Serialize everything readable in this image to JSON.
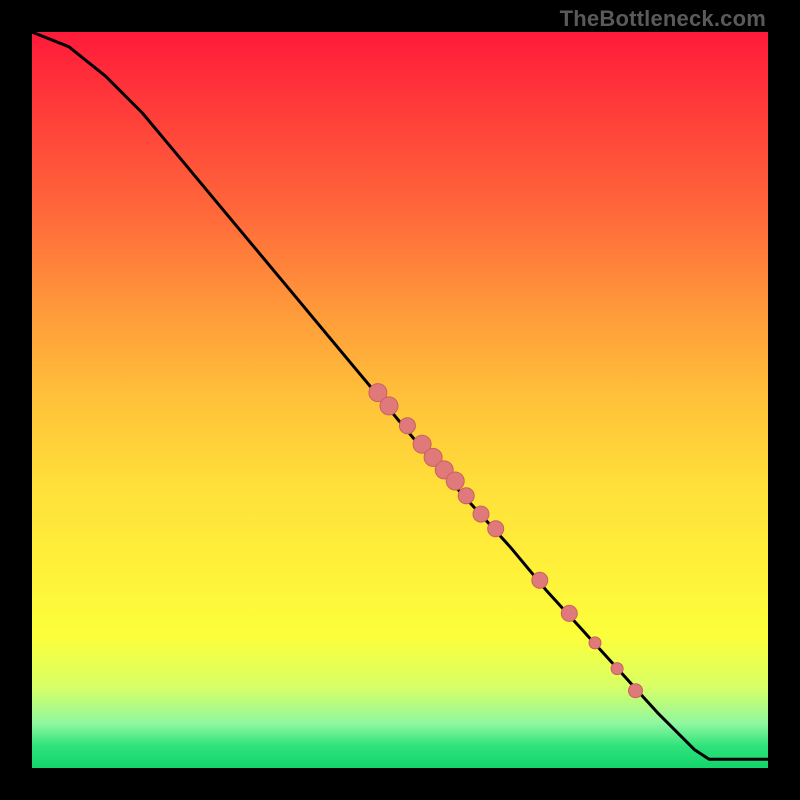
{
  "attribution": "TheBottleneck.com",
  "colors": {
    "curve": "#000000",
    "point_fill": "#e07a7a",
    "point_stroke": "#c96060"
  },
  "chart_data": {
    "type": "line",
    "title": "",
    "xlabel": "",
    "ylabel": "",
    "xlim": [
      0,
      100
    ],
    "ylim": [
      0,
      100
    ],
    "curve": [
      {
        "x": 0,
        "y": 100
      },
      {
        "x": 5,
        "y": 98
      },
      {
        "x": 10,
        "y": 94
      },
      {
        "x": 15,
        "y": 89
      },
      {
        "x": 20,
        "y": 83
      },
      {
        "x": 25,
        "y": 77
      },
      {
        "x": 30,
        "y": 71
      },
      {
        "x": 35,
        "y": 65
      },
      {
        "x": 40,
        "y": 59
      },
      {
        "x": 45,
        "y": 53
      },
      {
        "x": 50,
        "y": 47
      },
      {
        "x": 55,
        "y": 41
      },
      {
        "x": 60,
        "y": 35.5
      },
      {
        "x": 65,
        "y": 30
      },
      {
        "x": 70,
        "y": 24
      },
      {
        "x": 75,
        "y": 18.5
      },
      {
        "x": 80,
        "y": 13
      },
      {
        "x": 85,
        "y": 7.5
      },
      {
        "x": 90,
        "y": 2.5
      },
      {
        "x": 92,
        "y": 1.2
      },
      {
        "x": 95,
        "y": 1.2
      },
      {
        "x": 100,
        "y": 1.2
      }
    ],
    "points": [
      {
        "x": 47,
        "y": 51,
        "r": 9
      },
      {
        "x": 48.5,
        "y": 49.2,
        "r": 9
      },
      {
        "x": 51,
        "y": 46.5,
        "r": 8
      },
      {
        "x": 53,
        "y": 44,
        "r": 9
      },
      {
        "x": 54.5,
        "y": 42.2,
        "r": 9
      },
      {
        "x": 56,
        "y": 40.5,
        "r": 9
      },
      {
        "x": 57.5,
        "y": 39,
        "r": 9
      },
      {
        "x": 59,
        "y": 37,
        "r": 8
      },
      {
        "x": 61,
        "y": 34.5,
        "r": 8
      },
      {
        "x": 63,
        "y": 32.5,
        "r": 8
      },
      {
        "x": 69,
        "y": 25.5,
        "r": 8
      },
      {
        "x": 73,
        "y": 21,
        "r": 8
      },
      {
        "x": 76.5,
        "y": 17,
        "r": 6
      },
      {
        "x": 79.5,
        "y": 13.5,
        "r": 6
      },
      {
        "x": 82,
        "y": 10.5,
        "r": 7
      }
    ]
  }
}
